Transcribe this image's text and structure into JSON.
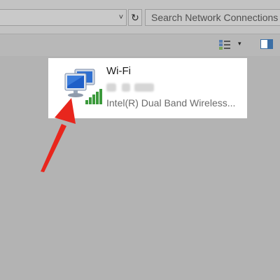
{
  "address_bar": {
    "dropdown_glyph": "˅",
    "refresh_glyph": "↻"
  },
  "search": {
    "placeholder": "Search Network Connections"
  },
  "toolbar": {
    "view_dropdown_glyph": "▾"
  },
  "connection": {
    "name": "Wi-Fi",
    "adapter": "Intel(R) Dual Band Wireless..."
  },
  "colors": {
    "arrow": "#e8261d",
    "signal": "#3c9a3c",
    "card": "#ffffff"
  }
}
